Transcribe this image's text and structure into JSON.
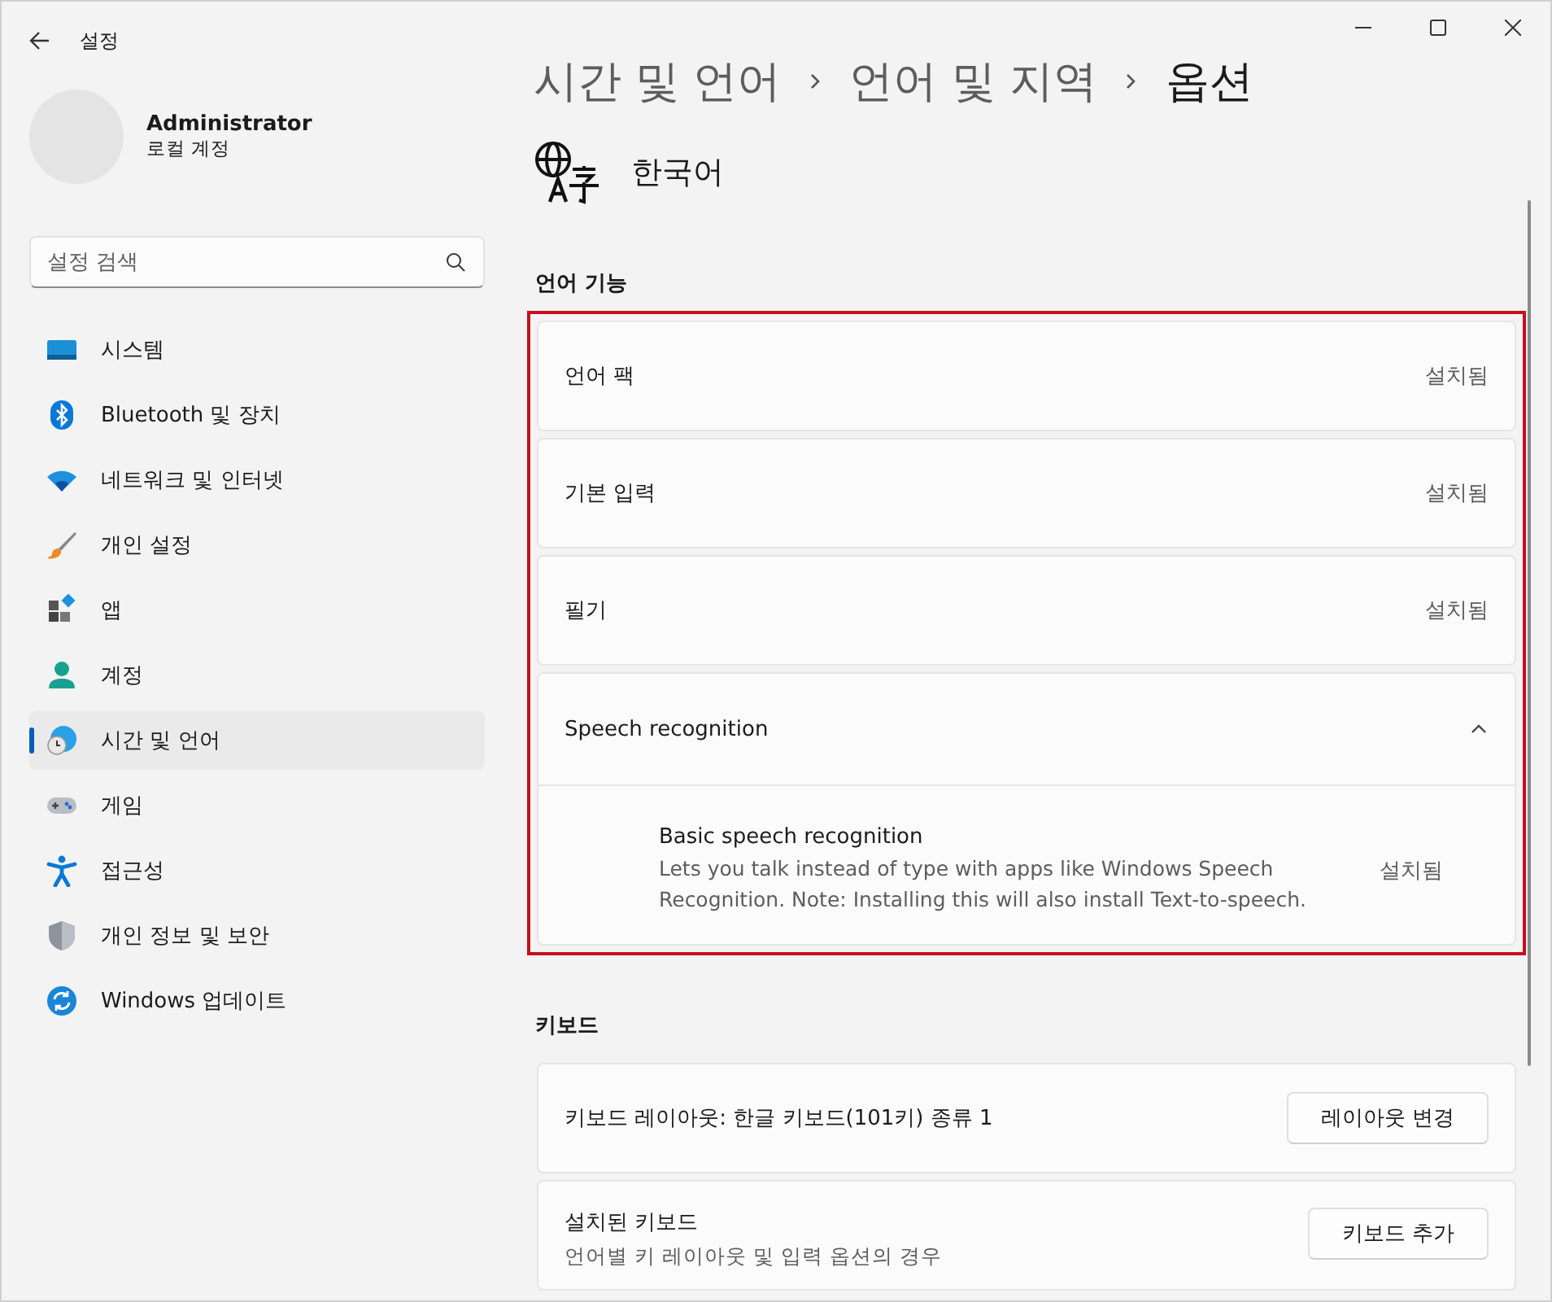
{
  "window": {
    "title": "설정"
  },
  "account": {
    "name": "Administrator",
    "type": "로컬 계정"
  },
  "search": {
    "placeholder": "설정 검색"
  },
  "nav": [
    {
      "kind": "system",
      "label": "시스템",
      "selected": false
    },
    {
      "kind": "bluetooth",
      "label": "Bluetooth 및 장치",
      "selected": false
    },
    {
      "kind": "network",
      "label": "네트워크 및 인터넷",
      "selected": false
    },
    {
      "kind": "personalize",
      "label": "개인 설정",
      "selected": false
    },
    {
      "kind": "apps",
      "label": "앱",
      "selected": false
    },
    {
      "kind": "accounts",
      "label": "계정",
      "selected": false
    },
    {
      "kind": "time",
      "label": "시간 및 언어",
      "selected": true
    },
    {
      "kind": "gaming",
      "label": "게임",
      "selected": false
    },
    {
      "kind": "accessibility",
      "label": "접근성",
      "selected": false
    },
    {
      "kind": "privacy",
      "label": "개인 정보 및 보안",
      "selected": false
    },
    {
      "kind": "update",
      "label": "Windows 업데이트",
      "selected": false
    }
  ],
  "breadcrumb": [
    {
      "label": "시간 및 언어",
      "current": false
    },
    {
      "label": "언어 및 지역",
      "current": false
    },
    {
      "label": "옵션",
      "current": true
    }
  ],
  "language": {
    "name": "한국어"
  },
  "sections": [
    {
      "title": "언어 기능",
      "highlighted": true,
      "items": [
        {
          "kind": "status",
          "label": "언어 팩",
          "status": "설치됨"
        },
        {
          "kind": "status",
          "label": "기본 입력",
          "status": "설치됨"
        },
        {
          "kind": "status",
          "label": "필기",
          "status": "설치됨"
        },
        {
          "kind": "expander",
          "label": "Speech recognition",
          "expanded": true,
          "children": [
            {
              "title": "Basic speech recognition",
              "description": "Lets you talk instead of type with apps like Windows Speech Recognition. Note: Installing this will also install Text-to-speech.",
              "status": "설치됨"
            }
          ]
        }
      ]
    },
    {
      "title": "키보드",
      "highlighted": false,
      "items": [
        {
          "kind": "button",
          "label": "키보드 레이아웃: 한글 키보드(101키) 종류 1",
          "button": "레이아웃 변경"
        },
        {
          "kind": "button",
          "label": "설치된 키보드",
          "description": "언어별 키 레이아웃 및 입력 옵션의 경우",
          "button": "키보드 추가"
        }
      ]
    }
  ]
}
